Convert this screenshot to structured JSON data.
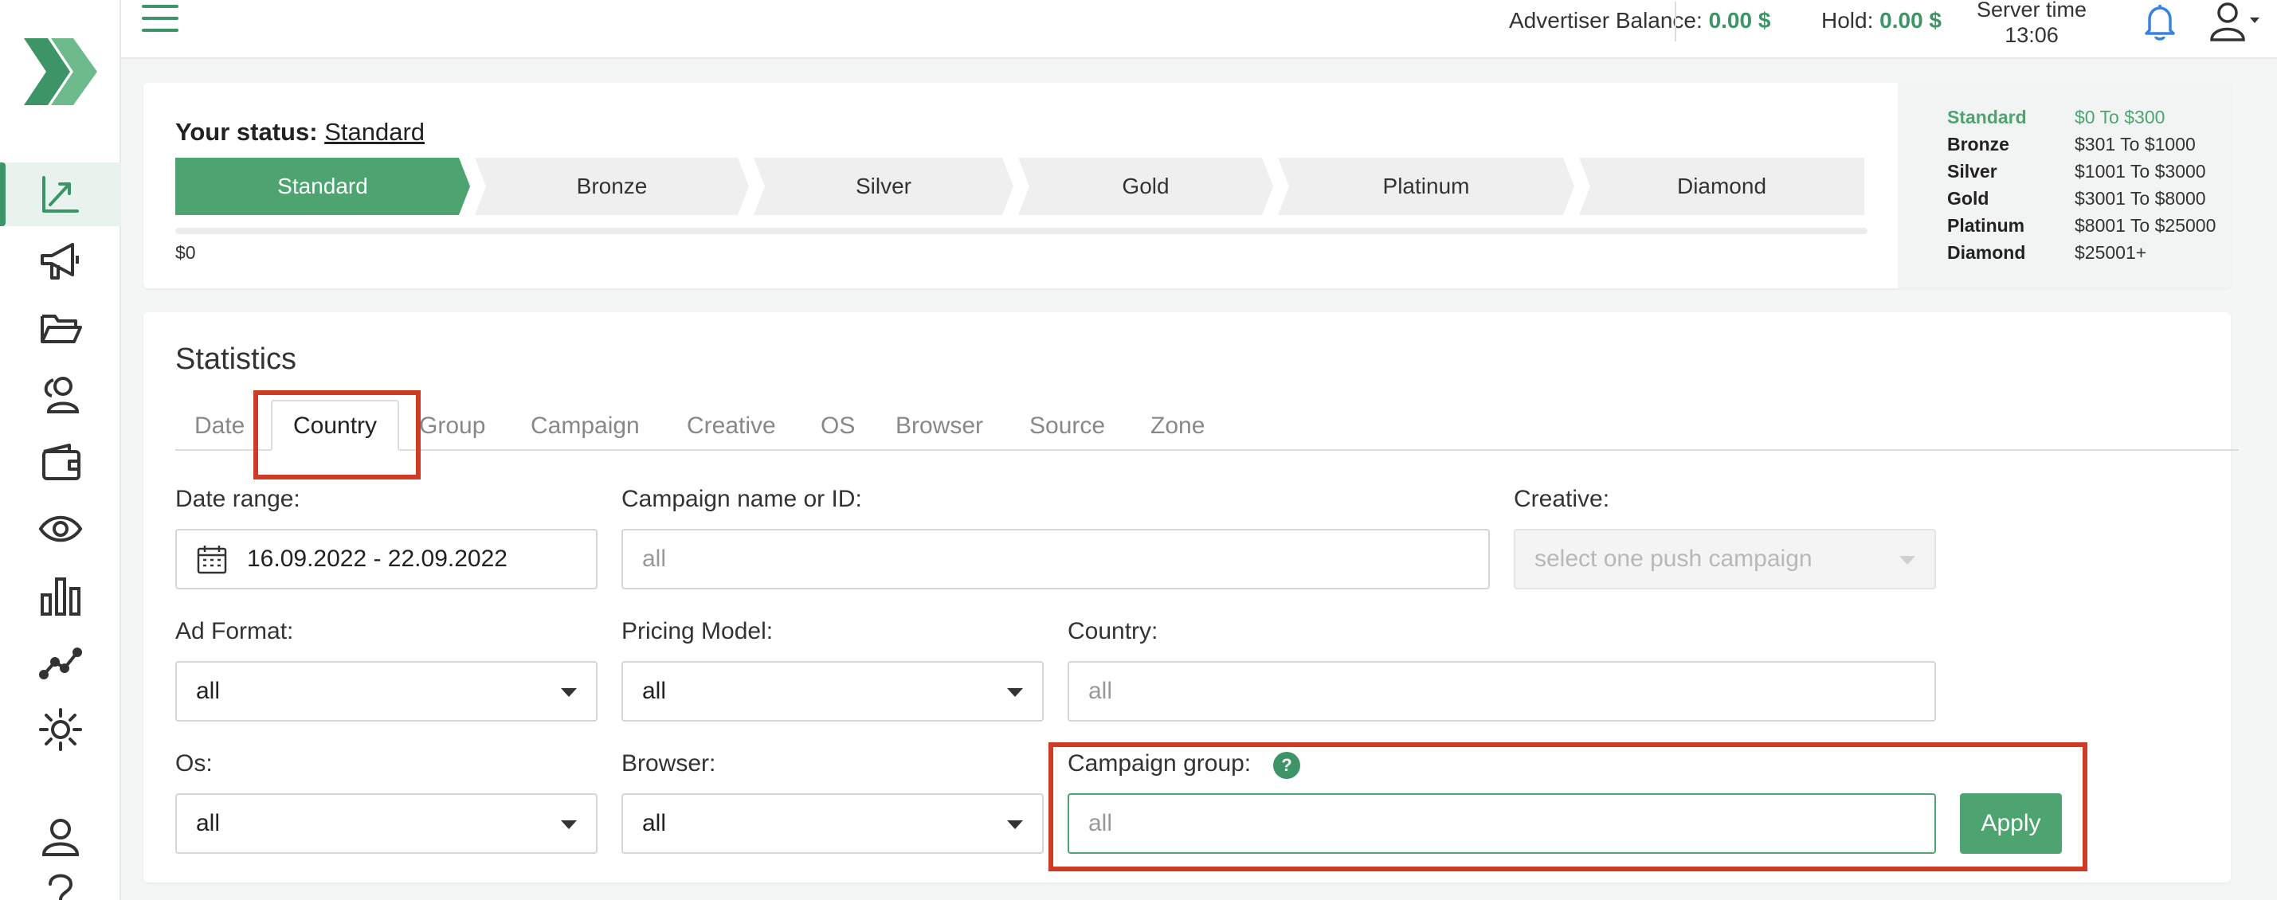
{
  "header": {
    "advertiser_balance_label": "Advertiser Balance:",
    "advertiser_balance_value": "0.00 $",
    "hold_label": "Hold:",
    "hold_value": "0.00 $",
    "server_time_label": "Server time",
    "server_time_value": "13:06"
  },
  "sidebar": {
    "items": [
      {
        "icon": "dashboard-chart-icon",
        "active": true
      },
      {
        "icon": "megaphone-icon"
      },
      {
        "icon": "folder-icon"
      },
      {
        "icon": "audience-icon"
      },
      {
        "icon": "wallet-icon"
      },
      {
        "icon": "eye-icon"
      },
      {
        "icon": "bar-chart-icon"
      },
      {
        "icon": "line-graph-icon"
      },
      {
        "icon": "sun-icon"
      },
      {
        "icon": "user-icon"
      },
      {
        "icon": "help-icon"
      }
    ]
  },
  "status": {
    "label": "Your status:",
    "current": "Standard",
    "steps": [
      "Standard",
      "Bronze",
      "Silver",
      "Gold",
      "Platinum",
      "Diamond"
    ],
    "progress_min": "$0",
    "progress_fraction": 0,
    "tiers": [
      {
        "name": "Standard",
        "range": "$0 To $300"
      },
      {
        "name": "Bronze",
        "range": "$301 To $1000"
      },
      {
        "name": "Silver",
        "range": "$1001 To $3000"
      },
      {
        "name": "Gold",
        "range": "$3001 To $8000"
      },
      {
        "name": "Platinum",
        "range": "$8001 To $25000"
      },
      {
        "name": "Diamond",
        "range": "$25001+"
      }
    ]
  },
  "statistics": {
    "title": "Statistics",
    "tabs": [
      "Date",
      "Country",
      "Group",
      "Campaign",
      "Creative",
      "OS",
      "Browser",
      "Source",
      "Zone"
    ],
    "active_tab": "Country",
    "filters": {
      "date_range": {
        "label": "Date range:",
        "value": "16.09.2022 - 22.09.2022"
      },
      "campaign_name": {
        "label": "Campaign name or ID:",
        "placeholder": "all"
      },
      "creative": {
        "label": "Creative:",
        "placeholder": "select one push campaign"
      },
      "ad_format": {
        "label": "Ad Format:",
        "value": "all"
      },
      "pricing_model": {
        "label": "Pricing Model:",
        "value": "all"
      },
      "country": {
        "label": "Country:",
        "placeholder": "all"
      },
      "os": {
        "label": "Os:",
        "value": "all"
      },
      "browser": {
        "label": "Browser:",
        "value": "all"
      },
      "campaign_group": {
        "label": "Campaign group:",
        "placeholder": "all",
        "help": "?"
      }
    },
    "apply_label": "Apply"
  },
  "colors": {
    "accent": "#4ea471",
    "highlight": "#d23a28"
  }
}
